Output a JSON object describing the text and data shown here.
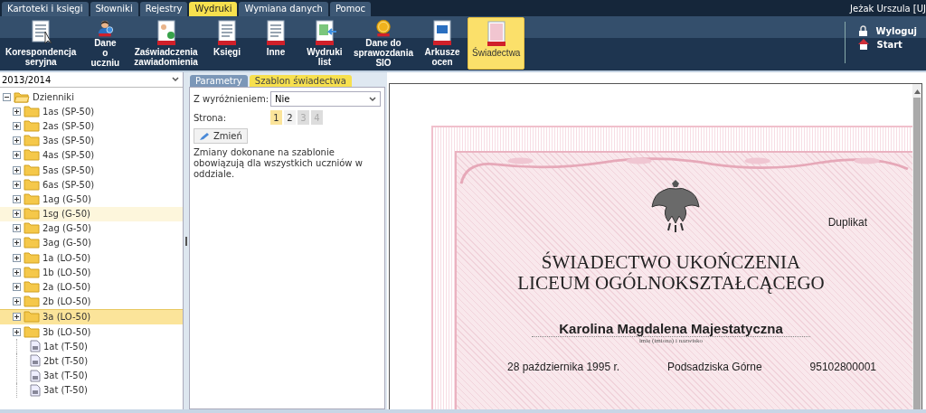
{
  "menu_tabs": [
    {
      "label": "Kartoteki i księgi",
      "selected": false
    },
    {
      "label": "Słowniki",
      "selected": false
    },
    {
      "label": "Rejestry",
      "selected": false
    },
    {
      "label": "Wydruki",
      "selected": true
    },
    {
      "label": "Wymiana danych",
      "selected": false
    },
    {
      "label": "Pomoc",
      "selected": false
    }
  ],
  "user": "Jeżak Urszula [UJ",
  "ribbon": [
    {
      "label": "Korespondencja seryjna",
      "kind": "letter",
      "pdf": false,
      "selected": false
    },
    {
      "label": "Dane o uczniu",
      "kind": "person",
      "pdf": true,
      "selected": false
    },
    {
      "label": "Zaświadczenia zawiadomienia",
      "kind": "certificate",
      "pdf": true,
      "selected": false
    },
    {
      "label": "Księgi",
      "kind": "book",
      "pdf": true,
      "selected": false
    },
    {
      "label": "Inne",
      "kind": "pages",
      "pdf": true,
      "selected": false
    },
    {
      "label": "Wydruki list",
      "kind": "list",
      "pdf": true,
      "selected": false
    },
    {
      "label": "Dane do sprawozdania SIO",
      "kind": "coin",
      "pdf": true,
      "selected": false
    },
    {
      "label": "Arkusze ocen",
      "kind": "grade",
      "pdf": true,
      "selected": false
    },
    {
      "label": "Świadectwa",
      "kind": "diploma",
      "pdf": true,
      "selected": true
    }
  ],
  "side_actions": [
    {
      "label": "Wyloguj",
      "kind": "logout"
    },
    {
      "label": "Start",
      "kind": "home"
    }
  ],
  "year_select": {
    "value": "2013/2014"
  },
  "tree": {
    "label": "Dzienniki",
    "expanded": true,
    "children": [
      {
        "label": "1as (SP-50)",
        "kind": "folder",
        "selected": false,
        "hovered": false
      },
      {
        "label": "2as (SP-50)",
        "kind": "folder",
        "selected": false,
        "hovered": false
      },
      {
        "label": "3as (SP-50)",
        "kind": "folder",
        "selected": false,
        "hovered": false
      },
      {
        "label": "4as (SP-50)",
        "kind": "folder",
        "selected": false,
        "hovered": false
      },
      {
        "label": "5as (SP-50)",
        "kind": "folder",
        "selected": false,
        "hovered": false
      },
      {
        "label": "6as (SP-50)",
        "kind": "folder",
        "selected": false,
        "hovered": false
      },
      {
        "label": "1ag (G-50)",
        "kind": "folder",
        "selected": false,
        "hovered": false
      },
      {
        "label": "1sg (G-50)",
        "kind": "folder",
        "selected": false,
        "hovered": true
      },
      {
        "label": "2ag (G-50)",
        "kind": "folder",
        "selected": false,
        "hovered": false
      },
      {
        "label": "3ag (G-50)",
        "kind": "folder",
        "selected": false,
        "hovered": false
      },
      {
        "label": "1a (LO-50)",
        "kind": "folder",
        "selected": false,
        "hovered": false
      },
      {
        "label": "1b (LO-50)",
        "kind": "folder",
        "selected": false,
        "hovered": false
      },
      {
        "label": "2a (LO-50)",
        "kind": "folder",
        "selected": false,
        "hovered": false
      },
      {
        "label": "2b (LO-50)",
        "kind": "folder",
        "selected": false,
        "hovered": false
      },
      {
        "label": "3a (LO-50)",
        "kind": "folder",
        "selected": true,
        "hovered": false
      },
      {
        "label": "3b (LO-50)",
        "kind": "folder",
        "selected": false,
        "hovered": false
      },
      {
        "label": "1at (T-50)",
        "kind": "file",
        "selected": false,
        "hovered": false
      },
      {
        "label": "2bt (T-50)",
        "kind": "file",
        "selected": false,
        "hovered": false
      },
      {
        "label": "3at (T-50)",
        "kind": "file",
        "selected": false,
        "hovered": false
      },
      {
        "label": "3at (T-50)",
        "kind": "file",
        "selected": false,
        "hovered": false
      }
    ]
  },
  "panel_tabs": [
    {
      "label": "Parametry",
      "selected": false
    },
    {
      "label": "Szablon świadectwa",
      "selected": true
    }
  ],
  "form": {
    "distinction_label": "Z wyróżnieniem:",
    "distinction_value": "Nie",
    "page_label": "Strona:",
    "pages": [
      {
        "label": "1",
        "selected": true,
        "disabled": false
      },
      {
        "label": "2",
        "selected": false,
        "disabled": false
      },
      {
        "label": "3",
        "selected": false,
        "disabled": true
      },
      {
        "label": "4",
        "selected": false,
        "disabled": true
      }
    ],
    "change_button": "Zmień",
    "note": "Zmiany dokonane na szablonie obowiązują dla wszystkich uczniów w oddziale."
  },
  "certificate": {
    "duplicate": "Duplikat",
    "title_lines": [
      "ŚWIADECTWO UKOŃCZENIA",
      "LICEUM OGÓLNOKSZTAŁCĄCEGO"
    ],
    "student_name": "Karolina Magdalena Majestatyczna",
    "name_caption": "imię (imiona) i nazwisko",
    "details": [
      "28 października 1995 r.",
      "Podsadziska Górne",
      "95102800001"
    ]
  }
}
